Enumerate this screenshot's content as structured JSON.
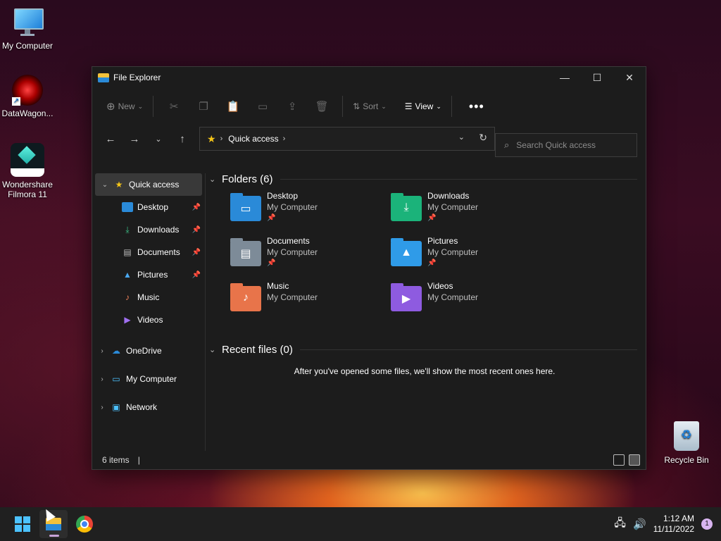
{
  "desktop": {
    "icons": [
      {
        "label": "My Computer"
      },
      {
        "label": "DataWagon..."
      },
      {
        "label": "Wondershare Filmora 11"
      },
      {
        "label": "Recycle Bin"
      }
    ]
  },
  "window": {
    "title": "File Explorer",
    "controls": {
      "minimize": "—",
      "maximize": "☐",
      "close": "✕"
    },
    "toolbar": {
      "new_label": "New",
      "sort_label": "Sort",
      "view_label": "View",
      "more_label": "•••"
    },
    "address": {
      "location": "Quick access"
    },
    "search": {
      "placeholder": "Search Quick access"
    }
  },
  "sidebar": {
    "quick_access": "Quick access",
    "items": [
      {
        "label": "Desktop",
        "pinned": true
      },
      {
        "label": "Downloads",
        "pinned": true
      },
      {
        "label": "Documents",
        "pinned": true
      },
      {
        "label": "Pictures",
        "pinned": true
      },
      {
        "label": "Music",
        "pinned": false
      },
      {
        "label": "Videos",
        "pinned": false
      }
    ],
    "roots": [
      {
        "label": "OneDrive"
      },
      {
        "label": "My Computer"
      },
      {
        "label": "Network"
      }
    ]
  },
  "main": {
    "folders_heading": "Folders (6)",
    "folders": [
      {
        "name": "Desktop",
        "location": "My Computer",
        "pinned": true
      },
      {
        "name": "Downloads",
        "location": "My Computer",
        "pinned": true
      },
      {
        "name": "Documents",
        "location": "My Computer",
        "pinned": true
      },
      {
        "name": "Pictures",
        "location": "My Computer",
        "pinned": true
      },
      {
        "name": "Music",
        "location": "My Computer",
        "pinned": false
      },
      {
        "name": "Videos",
        "location": "My Computer",
        "pinned": false
      }
    ],
    "recent_heading": "Recent files (0)",
    "recent_message": "After you've opened some files, we'll show the most recent ones here."
  },
  "status": {
    "items_count": "6 items"
  },
  "taskbar": {
    "time": "1:12 AM",
    "date": "11/11/2022",
    "notification_count": "1"
  },
  "colors": {
    "accent": "#4cc2ff",
    "folder_blue": "#2a8ad8",
    "folder_yellow": "#f3c13a"
  }
}
